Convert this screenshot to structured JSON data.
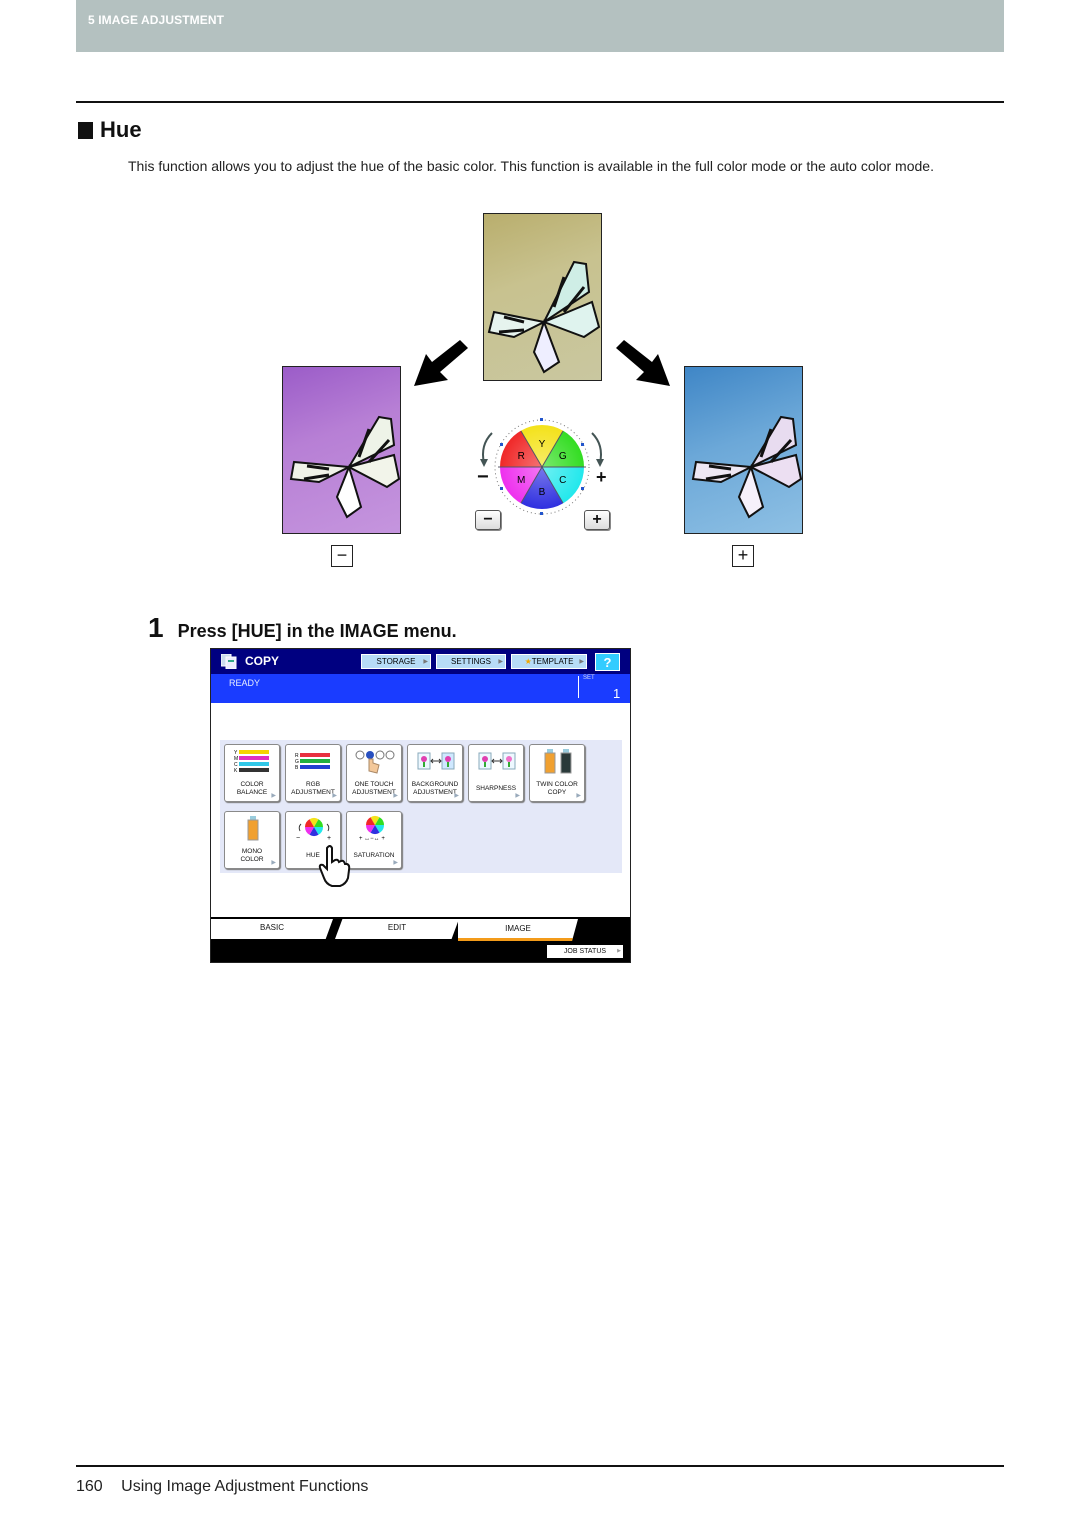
{
  "header": {
    "chapter": "5 IMAGE ADJUSTMENT"
  },
  "section": {
    "title": "Hue",
    "intro": "This function allows you to adjust the hue of the basic color. This function is available in the full color mode or the auto color mode."
  },
  "illustration": {
    "wheel_segments": [
      "Y",
      "G",
      "C",
      "B",
      "M",
      "R"
    ],
    "minus_symbol": "−",
    "plus_symbol": "+",
    "minus_button": "−",
    "plus_button": "+",
    "left_result_button": "−",
    "right_result_button": "+",
    "colors": {
      "original_bg": "#c5c08c",
      "minus_bg": "#b07ad4",
      "plus_bg": "#6aa6d8"
    }
  },
  "step": {
    "number": "1",
    "text": "Press [HUE] in the IMAGE menu."
  },
  "panel": {
    "title": "COPY",
    "buttons": {
      "storage": "STORAGE",
      "settings": "SETTINGS",
      "template": "TEMPLATE",
      "help": "?"
    },
    "status": "READY",
    "set_label": "SET",
    "set_value": "1",
    "functions_row1": [
      {
        "line1": "COLOR",
        "line2": "BALANCE"
      },
      {
        "line1": "RGB",
        "line2": "ADJUSTMENT"
      },
      {
        "line1": "ONE TOUCH",
        "line2": "ADJUSTMENT"
      },
      {
        "line1": "BACKGROUND",
        "line2": "ADJUSTMENT"
      },
      {
        "line1": "SHARPNESS",
        "line2": ""
      },
      {
        "line1": "TWIN COLOR",
        "line2": "COPY"
      }
    ],
    "functions_row2": [
      {
        "line1": "MONO",
        "line2": "COLOR"
      },
      {
        "line1": "HUE",
        "line2": ""
      },
      {
        "line1": "SATURATION",
        "line2": ""
      }
    ],
    "tabs": {
      "basic": "BASIC",
      "edit": "EDIT",
      "image": "IMAGE"
    },
    "active_tab": "IMAGE",
    "job_status": "JOB STATUS",
    "colors": {
      "title_bar": "#000080",
      "status_bar": "#1a3cff",
      "active_tab_underline": "#f39b1a",
      "help": "#33ccff"
    }
  },
  "footer": {
    "page_number": "160",
    "title": "Using Image Adjustment Functions"
  }
}
